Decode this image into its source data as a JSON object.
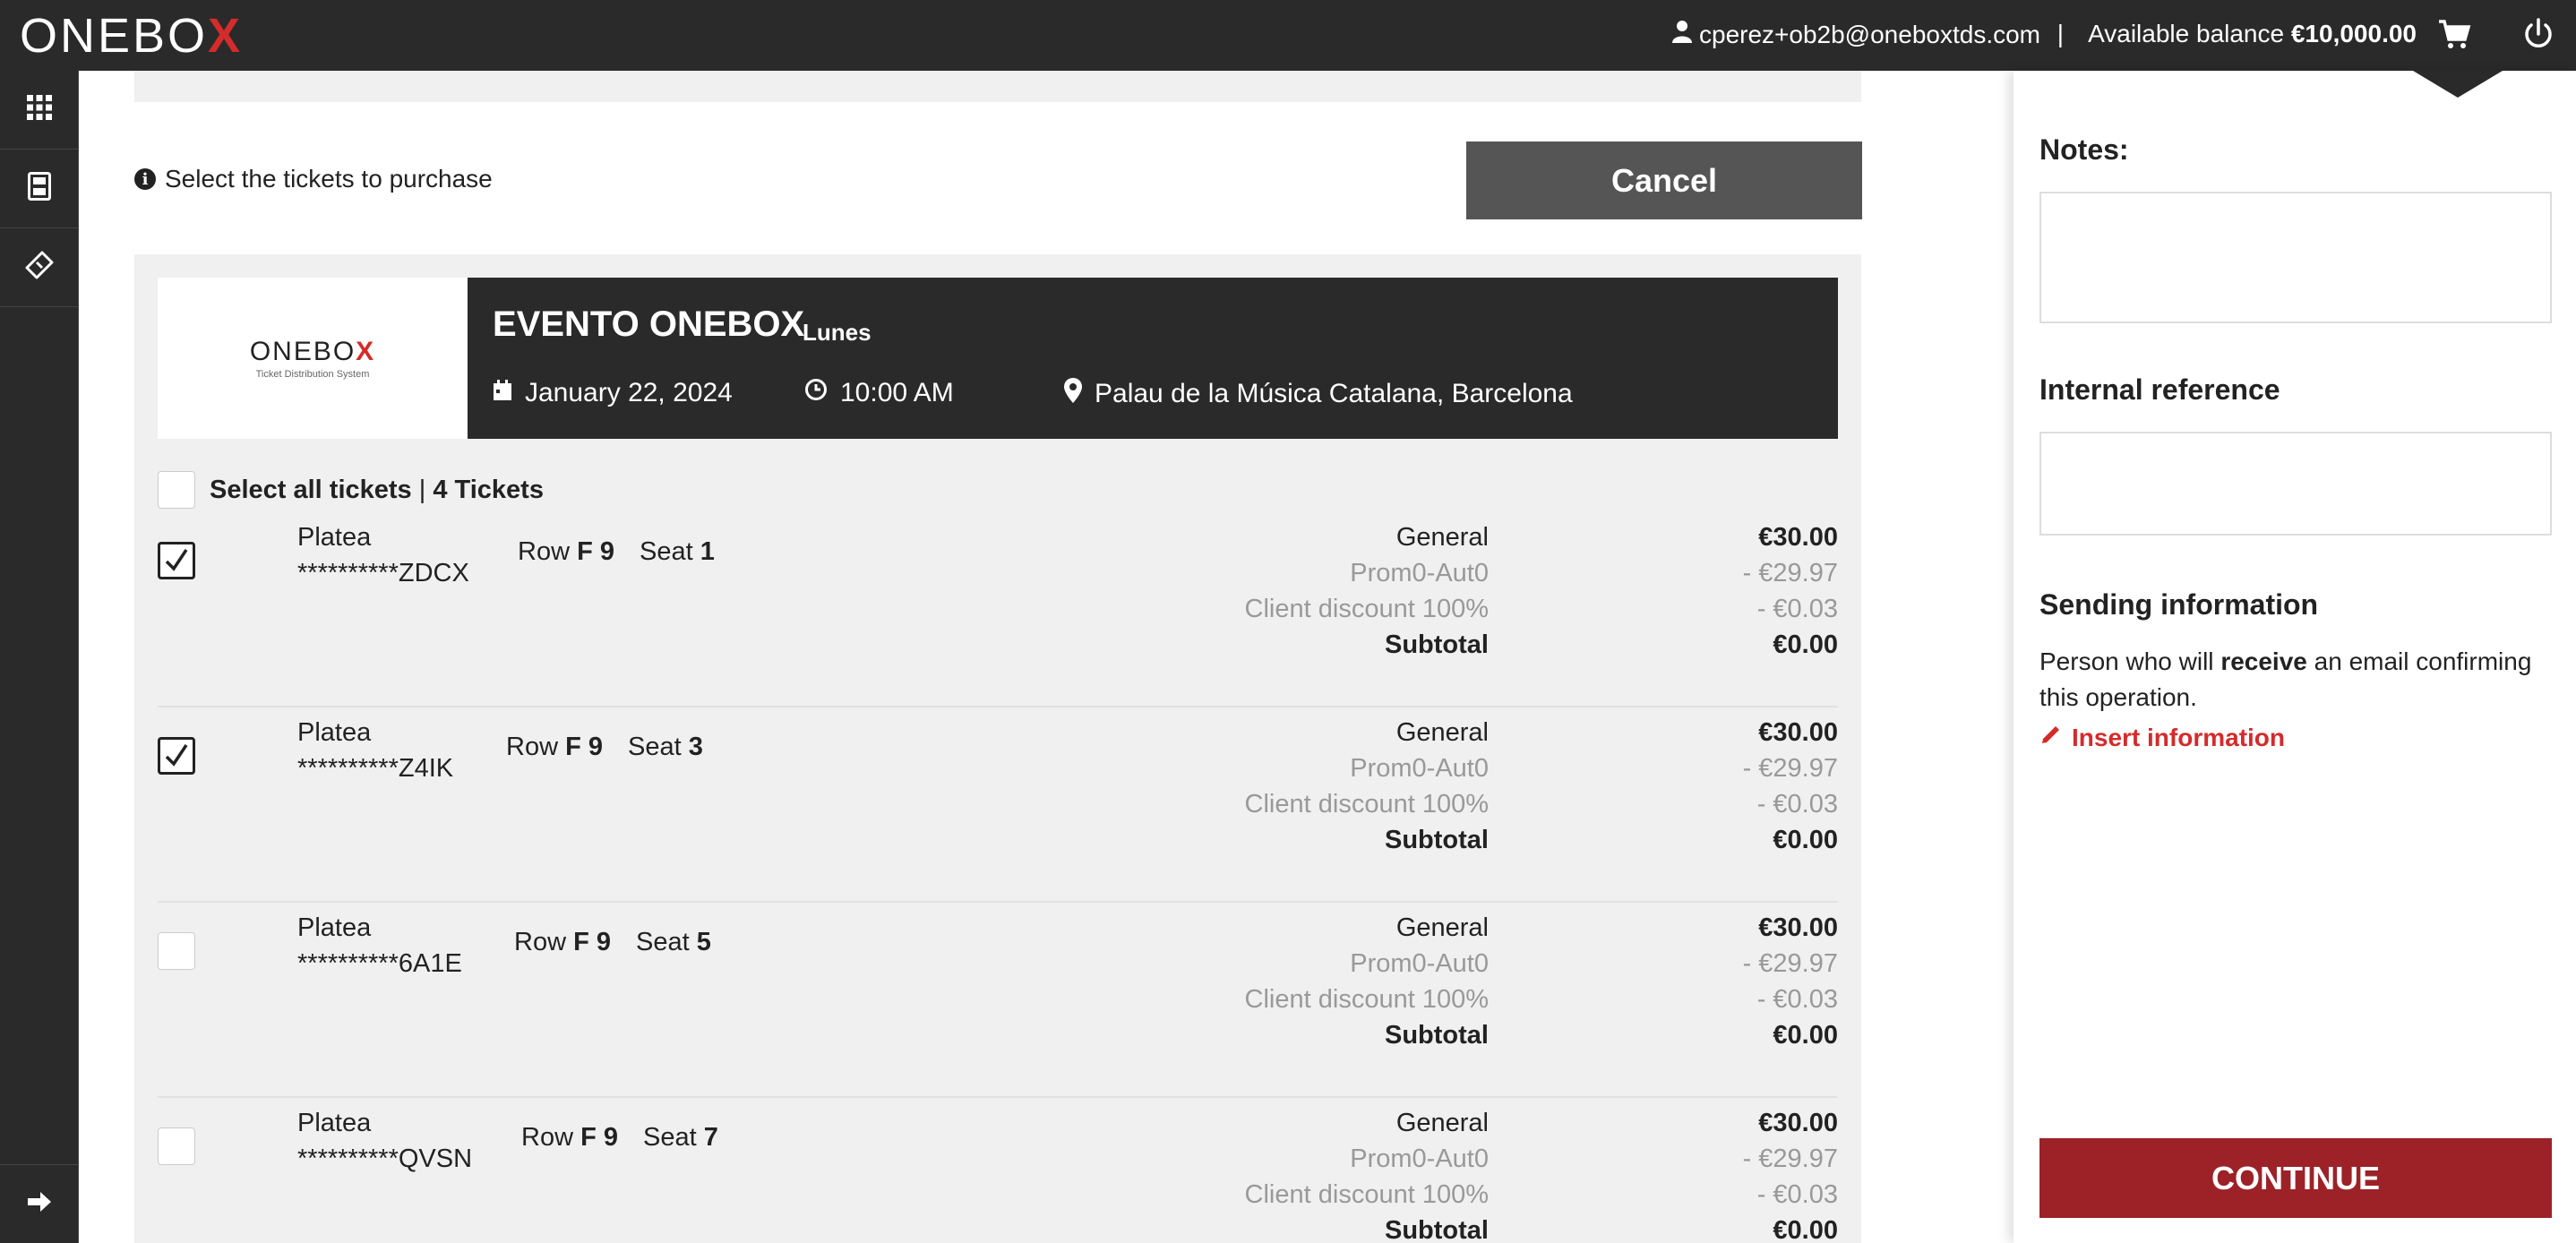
{
  "header": {
    "logo_text_a": "ONEBO",
    "logo_text_x": "X",
    "user_email": "cperez+ob2b@oneboxtds.com",
    "separator": "|",
    "balance_label": "Available balance",
    "balance_value": "€10,000.00",
    "icons": [
      "user-icon",
      "cart-icon",
      "power-icon"
    ]
  },
  "sidebar": {
    "items": [
      {
        "icon": "apps-grid-icon"
      },
      {
        "icon": "calculator-icon"
      },
      {
        "icon": "ticket-icon"
      }
    ],
    "bottom_icon": "arrow-right-icon"
  },
  "main": {
    "info_text": "Select the tickets to purchase",
    "cancel_label": "Cancel"
  },
  "event": {
    "logo_text_a": "ONEBO",
    "logo_text_x": "X",
    "logo_sub": "Ticket Distribution System",
    "title": "EVENTO ONEBOX",
    "day": "Lunes",
    "date": "January 22, 2024",
    "time": "10:00 AM",
    "venue": "Palau de la Música Catalana, Barcelona"
  },
  "select_all": {
    "label": "Select all tickets",
    "separator": "|",
    "count": "4 Tickets"
  },
  "tickets": [
    {
      "checked": true,
      "zone": "Platea",
      "code": "**********ZDCX",
      "row_label": "Row",
      "row": "F 9",
      "seat_label": "Seat",
      "seat": "1",
      "lines": [
        {
          "label": "General",
          "value": "€30.00"
        },
        {
          "label": "Prom0-Aut0",
          "value": "- €29.97"
        },
        {
          "label": "Client discount 100%",
          "value": "- €0.03"
        },
        {
          "label": "Subtotal",
          "value": "€0.00"
        }
      ]
    },
    {
      "checked": true,
      "zone": "Platea",
      "code": "**********Z4IK",
      "row_label": "Row",
      "row": "F 9",
      "seat_label": "Seat",
      "seat": "3",
      "lines": [
        {
          "label": "General",
          "value": "€30.00"
        },
        {
          "label": "Prom0-Aut0",
          "value": "- €29.97"
        },
        {
          "label": "Client discount 100%",
          "value": "- €0.03"
        },
        {
          "label": "Subtotal",
          "value": "€0.00"
        }
      ]
    },
    {
      "checked": false,
      "zone": "Platea",
      "code": "**********6A1E",
      "row_label": "Row",
      "row": "F 9",
      "seat_label": "Seat",
      "seat": "5",
      "lines": [
        {
          "label": "General",
          "value": "€30.00"
        },
        {
          "label": "Prom0-Aut0",
          "value": "- €29.97"
        },
        {
          "label": "Client discount 100%",
          "value": "- €0.03"
        },
        {
          "label": "Subtotal",
          "value": "€0.00"
        }
      ]
    },
    {
      "checked": false,
      "zone": "Platea",
      "code": "**********QVSN",
      "row_label": "Row",
      "row": "F 9",
      "seat_label": "Seat",
      "seat": "7",
      "lines": [
        {
          "label": "General",
          "value": "€30.00"
        },
        {
          "label": "Prom0-Aut0",
          "value": "- €29.97"
        },
        {
          "label": "Client discount 100%",
          "value": "- €0.03"
        },
        {
          "label": "Subtotal",
          "value": "€0.00"
        }
      ]
    }
  ],
  "right_panel": {
    "notes_label": "Notes:",
    "notes_value": "",
    "internal_ref_label": "Internal reference",
    "internal_ref_value": "",
    "sending_title": "Sending information",
    "sending_text_a": "Person who will",
    "sending_text_b": "receive",
    "sending_text_c": "an email confirming this operation.",
    "insert_link": "Insert information",
    "continue_label": "CONTINUE"
  },
  "colors": {
    "topbar": "#2a2a2a",
    "brand_red": "#d42b2b",
    "continue_button": "#9c2228",
    "cancel_button": "#555555",
    "panel_bg": "#f0f0f0"
  }
}
